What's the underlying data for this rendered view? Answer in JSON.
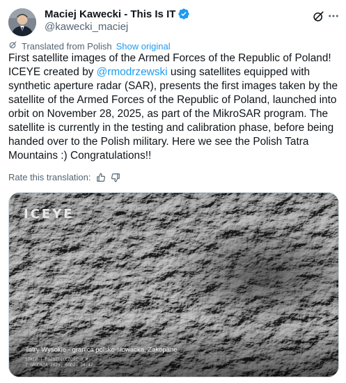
{
  "author": {
    "display_name": "Maciej Kawecki - This Is IT",
    "handle": "@kawecki_maciej",
    "verified": true
  },
  "icons": {
    "verified": "verified-badge-icon",
    "grok": "grok-icon",
    "more": "more-options-icon",
    "translate": "translate-icon",
    "thumbs_up": "thumbs-up-icon",
    "thumbs_down": "thumbs-down-icon"
  },
  "colors": {
    "accent": "#1d9bf0",
    "text": "#0f1419",
    "muted": "#536471"
  },
  "translation": {
    "label": "Translated from Polish",
    "show_original": "Show original"
  },
  "tweet": {
    "line1": "First satellite images of the Armed Forces of the Republic of Poland!",
    "line2_pre": "ICEYE created by ",
    "mention": "@rmodrzewski",
    "line2_post": " using satellites equipped with synthetic aperture radar (SAR), presents the first images taken by the satellite of the Armed Forces of the Republic of Poland, launched into orbit on November 28, 2025, as part of the MikroSAR program. The satellite is currently in the testing and calibration phase, before being handed over to the Polish military. Here we see the Polish Tatra Mountains :) Congratulations!!"
  },
  "rate": {
    "label": "Rate this translation:"
  },
  "media": {
    "brand": "ICEYE",
    "caption": "Tatry Wysokie - granica polsko-słowacka, Zakopane",
    "meta_line1": "STRIP | ROZDZIELCZOŚĆ 3 M",
    "meta_line2": "7 GRUDNIA 2025, GODZ. 20:47"
  }
}
